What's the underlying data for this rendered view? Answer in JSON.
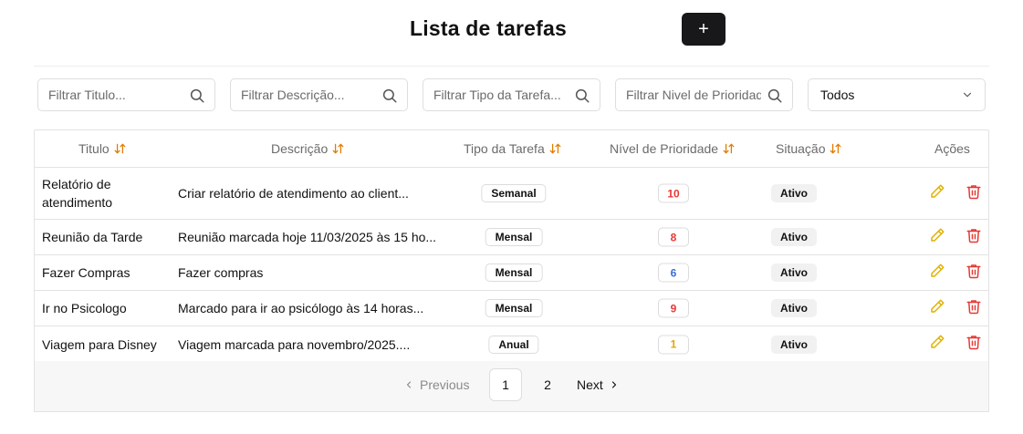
{
  "header": {
    "title": "Lista de tarefas",
    "add_label": "+"
  },
  "filters": {
    "title_placeholder": "Filtrar Titulo...",
    "description_placeholder": "Filtrar Descrição...",
    "type_placeholder": "Filtrar Tipo da Tarefa...",
    "priority_placeholder": "Filtrar Nivel de Prioridade",
    "status_selected": "Todos"
  },
  "table": {
    "columns": [
      "Titulo",
      "Descrição",
      "Tipo da Tarefa",
      "Nível de Prioridade",
      "Situação",
      "Ações"
    ],
    "rows": [
      {
        "title": "Relatório de atendimento",
        "description": "Criar relatório de atendimento ao client...",
        "type": "Semanal",
        "priority": "10",
        "priority_color": "#e53935",
        "status": "Ativo"
      },
      {
        "title": "Reunião da Tarde",
        "description": "Reunião marcada hoje 11/03/2025 às 15 ho...",
        "type": "Mensal",
        "priority": "8",
        "priority_color": "#e53935",
        "status": "Ativo"
      },
      {
        "title": "Fazer Compras",
        "description": "Fazer compras",
        "type": "Mensal",
        "priority": "6",
        "priority_color": "#3b6fd8",
        "status": "Ativo"
      },
      {
        "title": "Ir no Psicologo",
        "description": "Marcado para ir ao psicólogo às 14 horas...",
        "type": "Mensal",
        "priority": "9",
        "priority_color": "#e53935",
        "status": "Ativo"
      },
      {
        "title": "Viagem para Disney",
        "description": "Viagem marcada para novembro/2025....",
        "type": "Anual",
        "priority": "1",
        "priority_color": "#e0a800",
        "status": "Ativo"
      }
    ]
  },
  "pagination": {
    "previous_label": "Previous",
    "pages": [
      "1",
      "2"
    ],
    "next_label": "Next",
    "current": "1"
  },
  "colors": {
    "sort_icon": "#e07b00",
    "edit_icon": "#e0b100",
    "delete_icon": "#e53935",
    "primary_button": "#18181b"
  },
  "icons": {
    "search": "search-icon",
    "sort": "sort-icon",
    "edit": "pencil-icon",
    "delete": "trash-icon",
    "chevron": "chevron-down-icon"
  }
}
